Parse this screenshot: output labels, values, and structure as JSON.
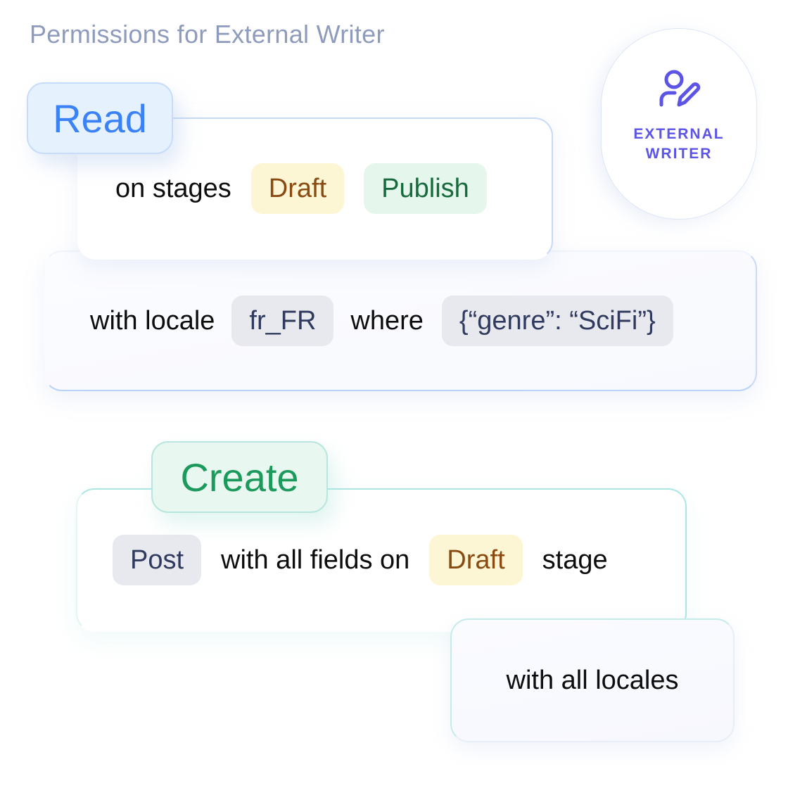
{
  "title": "Permissions for External Writer",
  "role": {
    "icon": "user-edit-icon",
    "label_line1": "EXTERNAL",
    "label_line2": "WRITER",
    "color": "#5b54e6"
  },
  "read_permission": {
    "action": "Read",
    "action_color": "#3b82f6",
    "stages_text": "on stages",
    "stages": [
      {
        "label": "Draft",
        "color": "#8a4b12",
        "bg": "#fdf6d5"
      },
      {
        "label": "Publish",
        "color": "#176a3c",
        "bg": "#e5f6ec"
      }
    ],
    "locale_text": "with locale",
    "locale": "fr_FR",
    "where_text": "where",
    "condition": "{“genre”: “SciFi”}"
  },
  "create_permission": {
    "action": "Create",
    "action_color": "#1b9a5c",
    "content_type": "Post",
    "fields_text": "with all fields on",
    "stage": "Draft",
    "stage_suffix": "stage",
    "locales_text": "with all locales"
  }
}
